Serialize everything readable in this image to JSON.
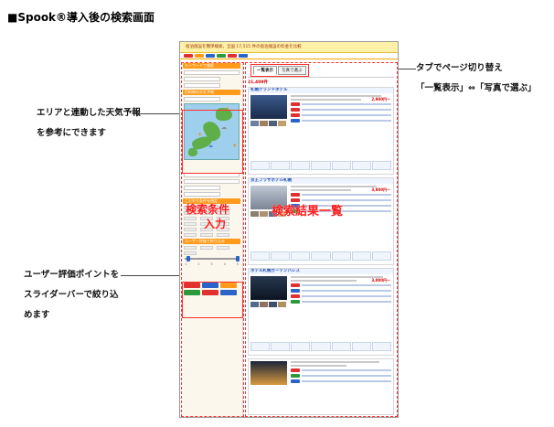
{
  "heading": "■Spook®導入後の検索画面",
  "annotations": {
    "tab_switch": {
      "line1": "タブでページ切り替え",
      "line2": "「一覧表示」⇔「写真で選ぶ」"
    },
    "weather": {
      "line1": "エリアと連動した天気予報",
      "line2": "を参考にできます"
    },
    "slider": {
      "line1": "ユーザー評価ポイントを",
      "line2": "スライダーバーで絞り込",
      "line3": "めます"
    }
  },
  "overlay_labels": {
    "conditions": "検索条件",
    "conditions_2": "入力",
    "results": "検索結果一覧"
  },
  "screenshot": {
    "banner_text": "宿泊施設を簡単検索。全国 17,515 件の宿泊施設の料金を比較",
    "left_panel": {
      "keyword_header": "キーワードで検索",
      "weather_header": "目的地の天気予報",
      "conditions_header": "こだわり条件を指定",
      "rating_header": "ユーザー評価で絞り込み",
      "slider_ticks": [
        "1",
        "2",
        "3",
        "4",
        "5"
      ]
    },
    "main": {
      "tabs": [
        {
          "label": "一覧表示",
          "active": true
        },
        {
          "label": "写真で選ぶ",
          "active": false
        }
      ],
      "hits": "21,409件",
      "cards": [
        {
          "title": "札幌グランドホテル",
          "price": "2,900円〜"
        },
        {
          "title": "京王プラザホテル札幌",
          "price": "3,800円〜"
        },
        {
          "title": "ホテル札幌ガーデンパレス",
          "price": "3,000円〜"
        }
      ]
    }
  },
  "colors": {
    "accent_orange": "#ff9a1a",
    "annotation_red": "#ff1a1a",
    "link_blue": "#1a4bb8"
  }
}
